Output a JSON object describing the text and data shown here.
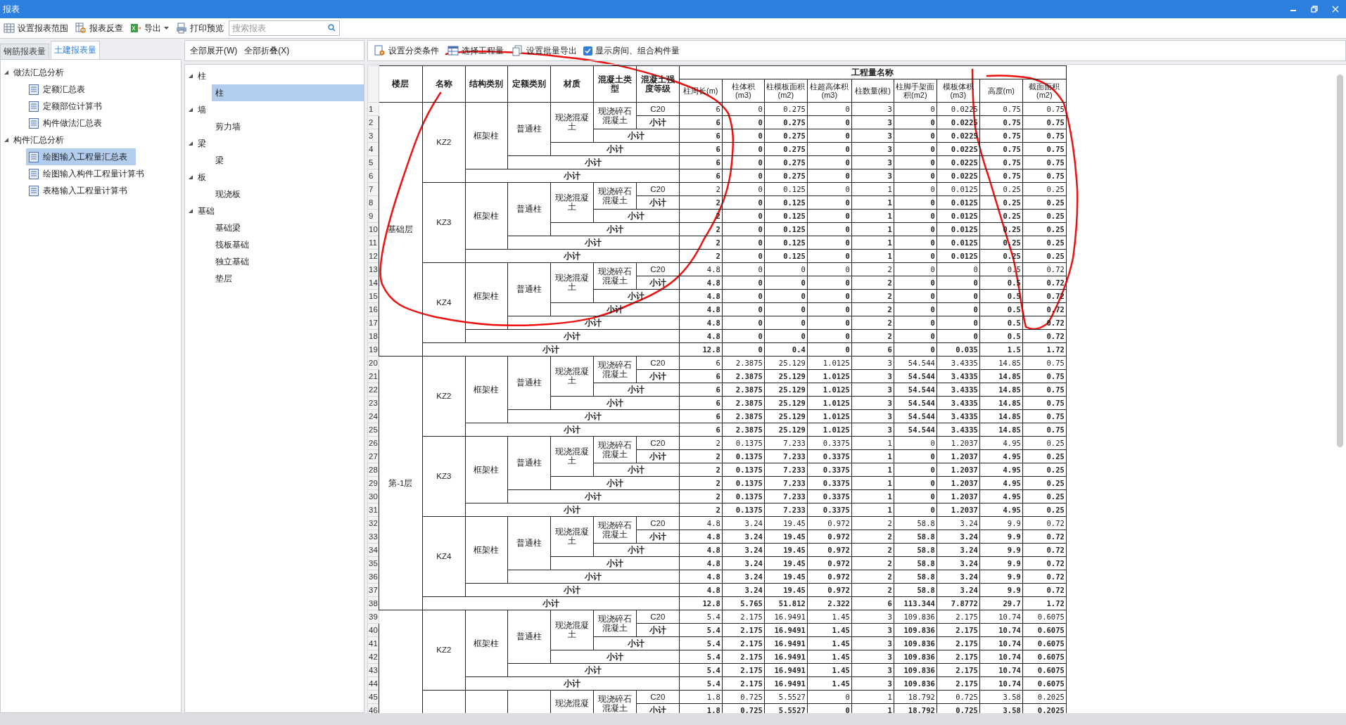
{
  "window": {
    "title": "报表"
  },
  "toolbar": {
    "buttons": [
      {
        "label": "设置报表范围",
        "kind": "range",
        "dropdown": false
      },
      {
        "label": "报表反查",
        "kind": "lookup",
        "dropdown": false
      },
      {
        "label": "导出",
        "kind": "export",
        "dropdown": true
      },
      {
        "label": "打印预览",
        "kind": "print",
        "dropdown": false
      }
    ],
    "search": {
      "placeholder": "搜索报表"
    }
  },
  "left_panel": {
    "tabs": [
      {
        "label": "钢筋报表量",
        "selected": false
      },
      {
        "label": "土建报表量",
        "selected": true
      }
    ],
    "tree": [
      {
        "label": "做法汇总分析",
        "expanded": true,
        "children": [
          {
            "label": "定额汇总表",
            "selected": false
          },
          {
            "label": "定额部位计算书",
            "selected": false
          },
          {
            "label": "构件做法汇总表",
            "selected": false
          }
        ]
      },
      {
        "label": "构件汇总分析",
        "expanded": true,
        "children": [
          {
            "label": "绘图输入工程量汇总表",
            "selected": true
          },
          {
            "label": "绘图输入构件工程量计算书",
            "selected": false
          },
          {
            "label": "表格输入工程量计算书",
            "selected": false
          }
        ]
      }
    ]
  },
  "middle_panel": {
    "buttons": [
      "全部展开(W)",
      "全部折叠(X)"
    ],
    "tree": [
      {
        "label": "柱",
        "expanded": true,
        "children": [
          {
            "label": "柱",
            "selected": true
          }
        ]
      },
      {
        "label": "墙",
        "expanded": true,
        "children": [
          {
            "label": "剪力墙",
            "selected": false
          }
        ]
      },
      {
        "label": "梁",
        "expanded": true,
        "children": [
          {
            "label": "梁",
            "selected": false
          }
        ]
      },
      {
        "label": "板",
        "expanded": true,
        "children": [
          {
            "label": "现浇板",
            "selected": false
          }
        ]
      },
      {
        "label": "基础",
        "expanded": true,
        "children": [
          {
            "label": "基础梁",
            "selected": false
          },
          {
            "label": "筏板基础",
            "selected": false
          },
          {
            "label": "独立基础",
            "selected": false
          },
          {
            "label": "垫层",
            "selected": false
          }
        ]
      }
    ]
  },
  "report_toolbar": {
    "buttons": [
      {
        "label": "设置分类条件",
        "kind": "classify"
      },
      {
        "label": "选择工程量",
        "kind": "select"
      },
      {
        "label": "设置批量导出",
        "kind": "batch"
      }
    ],
    "checkbox": {
      "label": "显示房间、组合构件量",
      "checked": true
    }
  },
  "table": {
    "header": {
      "fixed": [
        "楼层",
        "名称",
        "结构类别",
        "定额类别",
        "材质",
        "混凝土类型",
        "混凝土强度等级"
      ],
      "group": "工程量名称",
      "quantities": [
        "柱周长(m)",
        "柱体积(m3)",
        "柱模板面积(m2)",
        "柱超高体积(m3)",
        "柱数量(根)",
        "柱脚手架面积(m2)",
        "模板体积(m3)",
        "高度(m)",
        "截面面积(m2)"
      ]
    },
    "floors": [
      {
        "name": "基础层",
        "groups": [
          {
            "name": "KZ2",
            "structure": "框架柱",
            "quota": "普通柱",
            "material": "现浇混凝土",
            "concrete": "现浇碎石混凝土",
            "rows": [
              {
                "num": "1",
                "kind": "detail",
                "label": "C20",
                "values": [
                  "6",
                  "0",
                  "0.275",
                  "0",
                  "3",
                  "0",
                  "0.0225",
                  "0.75",
                  "0.75"
                ]
              },
              {
                "num": "2",
                "kind": "subtotal",
                "label": "小计",
                "values": [
                  "6",
                  "0",
                  "0.275",
                  "0",
                  "3",
                  "0",
                  "0.0225",
                  "0.75",
                  "0.75"
                ]
              },
              {
                "num": "3",
                "kind": "subtotal",
                "label": "小计",
                "values": [
                  "6",
                  "0",
                  "0.275",
                  "0",
                  "3",
                  "0",
                  "0.0225",
                  "0.75",
                  "0.75"
                ]
              },
              {
                "num": "4",
                "kind": "subtotal",
                "label": "小计",
                "values": [
                  "6",
                  "0",
                  "0.275",
                  "0",
                  "3",
                  "0",
                  "0.0225",
                  "0.75",
                  "0.75"
                ]
              },
              {
                "num": "5",
                "kind": "subtotal",
                "label": "小计",
                "values": [
                  "6",
                  "0",
                  "0.275",
                  "0",
                  "3",
                  "0",
                  "0.0225",
                  "0.75",
                  "0.75"
                ]
              },
              {
                "num": "6",
                "kind": "subtotal",
                "label": "小计",
                "values": [
                  "6",
                  "0",
                  "0.275",
                  "0",
                  "3",
                  "0",
                  "0.0225",
                  "0.75",
                  "0.75"
                ]
              }
            ]
          },
          {
            "name": "KZ3",
            "structure": "框架柱",
            "quota": "普通柱",
            "material": "现浇混凝土",
            "concrete": "现浇碎石混凝土",
            "rows": [
              {
                "num": "7",
                "kind": "detail",
                "label": "C20",
                "values": [
                  "2",
                  "0",
                  "0.125",
                  "0",
                  "1",
                  "0",
                  "0.0125",
                  "0.25",
                  "0.25"
                ]
              },
              {
                "num": "8",
                "kind": "subtotal",
                "label": "小计",
                "values": [
                  "2",
                  "0",
                  "0.125",
                  "0",
                  "1",
                  "0",
                  "0.0125",
                  "0.25",
                  "0.25"
                ]
              },
              {
                "num": "9",
                "kind": "subtotal",
                "label": "小计",
                "values": [
                  "2",
                  "0",
                  "0.125",
                  "0",
                  "1",
                  "0",
                  "0.0125",
                  "0.25",
                  "0.25"
                ]
              },
              {
                "num": "10",
                "kind": "subtotal",
                "label": "小计",
                "values": [
                  "2",
                  "0",
                  "0.125",
                  "0",
                  "1",
                  "0",
                  "0.0125",
                  "0.25",
                  "0.25"
                ]
              },
              {
                "num": "11",
                "kind": "subtotal",
                "label": "小计",
                "values": [
                  "2",
                  "0",
                  "0.125",
                  "0",
                  "1",
                  "0",
                  "0.0125",
                  "0.25",
                  "0.25"
                ]
              },
              {
                "num": "12",
                "kind": "subtotal",
                "label": "小计",
                "values": [
                  "2",
                  "0",
                  "0.125",
                  "0",
                  "1",
                  "0",
                  "0.0125",
                  "0.25",
                  "0.25"
                ]
              }
            ]
          },
          {
            "name": "KZ4",
            "structure": "框架柱",
            "quota": "普通柱",
            "material": "现浇混凝土",
            "concrete": "现浇碎石混凝土",
            "rows": [
              {
                "num": "13",
                "kind": "detail",
                "label": "C20",
                "values": [
                  "4.8",
                  "0",
                  "0",
                  "0",
                  "2",
                  "0",
                  "0",
                  "0.5",
                  "0.72"
                ]
              },
              {
                "num": "14",
                "kind": "subtotal",
                "label": "小计",
                "values": [
                  "4.8",
                  "0",
                  "0",
                  "0",
                  "2",
                  "0",
                  "0",
                  "0.5",
                  "0.72"
                ]
              },
              {
                "num": "15",
                "kind": "subtotal",
                "label": "小计",
                "values": [
                  "4.8",
                  "0",
                  "0",
                  "0",
                  "2",
                  "0",
                  "0",
                  "0.5",
                  "0.72"
                ]
              },
              {
                "num": "16",
                "kind": "subtotal",
                "label": "小计",
                "values": [
                  "4.8",
                  "0",
                  "0",
                  "0",
                  "2",
                  "0",
                  "0",
                  "0.5",
                  "0.72"
                ]
              },
              {
                "num": "17",
                "kind": "subtotal",
                "label": "小计",
                "values": [
                  "4.8",
                  "0",
                  "0",
                  "0",
                  "2",
                  "0",
                  "0",
                  "0.5",
                  "0.72"
                ]
              },
              {
                "num": "18",
                "kind": "subtotal",
                "label": "小计",
                "values": [
                  "4.8",
                  "0",
                  "0",
                  "0",
                  "2",
                  "0",
                  "0",
                  "0.5",
                  "0.72"
                ]
              }
            ]
          }
        ],
        "total": {
          "num": "19",
          "label": "小计",
          "values": [
            "12.8",
            "0",
            "0.4",
            "0",
            "6",
            "0",
            "0.035",
            "1.5",
            "1.72"
          ]
        }
      },
      {
        "name": "第-1层",
        "groups": [
          {
            "name": "KZ2",
            "structure": "框架柱",
            "quota": "普通柱",
            "material": "现浇混凝土",
            "concrete": "现浇碎石混凝土",
            "rows": [
              {
                "num": "20",
                "kind": "detail",
                "label": "C20",
                "values": [
                  "6",
                  "2.3875",
                  "25.129",
                  "1.0125",
                  "3",
                  "54.544",
                  "3.4335",
                  "14.85",
                  "0.75"
                ]
              },
              {
                "num": "21",
                "kind": "subtotal",
                "label": "小计",
                "values": [
                  "6",
                  "2.3875",
                  "25.129",
                  "1.0125",
                  "3",
                  "54.544",
                  "3.4335",
                  "14.85",
                  "0.75"
                ]
              },
              {
                "num": "22",
                "kind": "subtotal",
                "label": "小计",
                "values": [
                  "6",
                  "2.3875",
                  "25.129",
                  "1.0125",
                  "3",
                  "54.544",
                  "3.4335",
                  "14.85",
                  "0.75"
                ]
              },
              {
                "num": "23",
                "kind": "subtotal",
                "label": "小计",
                "values": [
                  "6",
                  "2.3875",
                  "25.129",
                  "1.0125",
                  "3",
                  "54.544",
                  "3.4335",
                  "14.85",
                  "0.75"
                ]
              },
              {
                "num": "24",
                "kind": "subtotal",
                "label": "小计",
                "values": [
                  "6",
                  "2.3875",
                  "25.129",
                  "1.0125",
                  "3",
                  "54.544",
                  "3.4335",
                  "14.85",
                  "0.75"
                ]
              },
              {
                "num": "25",
                "kind": "subtotal",
                "label": "小计",
                "values": [
                  "6",
                  "2.3875",
                  "25.129",
                  "1.0125",
                  "3",
                  "54.544",
                  "3.4335",
                  "14.85",
                  "0.75"
                ]
              }
            ]
          },
          {
            "name": "KZ3",
            "structure": "框架柱",
            "quota": "普通柱",
            "material": "现浇混凝土",
            "concrete": "现浇碎石混凝土",
            "rows": [
              {
                "num": "26",
                "kind": "detail",
                "label": "C20",
                "values": [
                  "2",
                  "0.1375",
                  "7.233",
                  "0.3375",
                  "1",
                  "0",
                  "1.2037",
                  "4.95",
                  "0.25"
                ]
              },
              {
                "num": "27",
                "kind": "subtotal",
                "label": "小计",
                "values": [
                  "2",
                  "0.1375",
                  "7.233",
                  "0.3375",
                  "1",
                  "0",
                  "1.2037",
                  "4.95",
                  "0.25"
                ]
              },
              {
                "num": "28",
                "kind": "subtotal",
                "label": "小计",
                "values": [
                  "2",
                  "0.1375",
                  "7.233",
                  "0.3375",
                  "1",
                  "0",
                  "1.2037",
                  "4.95",
                  "0.25"
                ]
              },
              {
                "num": "29",
                "kind": "subtotal",
                "label": "小计",
                "values": [
                  "2",
                  "0.1375",
                  "7.233",
                  "0.3375",
                  "1",
                  "0",
                  "1.2037",
                  "4.95",
                  "0.25"
                ]
              },
              {
                "num": "30",
                "kind": "subtotal",
                "label": "小计",
                "values": [
                  "2",
                  "0.1375",
                  "7.233",
                  "0.3375",
                  "1",
                  "0",
                  "1.2037",
                  "4.95",
                  "0.25"
                ]
              },
              {
                "num": "31",
                "kind": "subtotal",
                "label": "小计",
                "values": [
                  "2",
                  "0.1375",
                  "7.233",
                  "0.3375",
                  "1",
                  "0",
                  "1.2037",
                  "4.95",
                  "0.25"
                ]
              }
            ]
          },
          {
            "name": "KZ4",
            "structure": "框架柱",
            "quota": "普通柱",
            "material": "现浇混凝土",
            "concrete": "现浇碎石混凝土",
            "rows": [
              {
                "num": "32",
                "kind": "detail",
                "label": "C20",
                "values": [
                  "4.8",
                  "3.24",
                  "19.45",
                  "0.972",
                  "2",
                  "58.8",
                  "3.24",
                  "9.9",
                  "0.72"
                ]
              },
              {
                "num": "33",
                "kind": "subtotal",
                "label": "小计",
                "values": [
                  "4.8",
                  "3.24",
                  "19.45",
                  "0.972",
                  "2",
                  "58.8",
                  "3.24",
                  "9.9",
                  "0.72"
                ]
              },
              {
                "num": "34",
                "kind": "subtotal",
                "label": "小计",
                "values": [
                  "4.8",
                  "3.24",
                  "19.45",
                  "0.972",
                  "2",
                  "58.8",
                  "3.24",
                  "9.9",
                  "0.72"
                ]
              },
              {
                "num": "35",
                "kind": "subtotal",
                "label": "小计",
                "values": [
                  "4.8",
                  "3.24",
                  "19.45",
                  "0.972",
                  "2",
                  "58.8",
                  "3.24",
                  "9.9",
                  "0.72"
                ]
              },
              {
                "num": "36",
                "kind": "subtotal",
                "label": "小计",
                "values": [
                  "4.8",
                  "3.24",
                  "19.45",
                  "0.972",
                  "2",
                  "58.8",
                  "3.24",
                  "9.9",
                  "0.72"
                ]
              },
              {
                "num": "37",
                "kind": "subtotal",
                "label": "小计",
                "values": [
                  "4.8",
                  "3.24",
                  "19.45",
                  "0.972",
                  "2",
                  "58.8",
                  "3.24",
                  "9.9",
                  "0.72"
                ]
              }
            ]
          }
        ],
        "total": {
          "num": "38",
          "label": "小计",
          "values": [
            "12.8",
            "5.765",
            "51.812",
            "2.322",
            "6",
            "113.344",
            "7.8772",
            "29.7",
            "1.72"
          ]
        }
      },
      {
        "groups": [
          {
            "name": "KZ2",
            "structure": "框架柱",
            "quota": "普通柱",
            "material": "现浇混凝土",
            "concrete": "现浇碎石混凝土",
            "rows": [
              {
                "num": "39",
                "kind": "detail",
                "label": "C20",
                "values": [
                  "5.4",
                  "2.175",
                  "16.9491",
                  "1.45",
                  "3",
                  "109.836",
                  "2.175",
                  "10.74",
                  "0.6075"
                ]
              },
              {
                "num": "40",
                "kind": "subtotal",
                "label": "小计",
                "values": [
                  "5.4",
                  "2.175",
                  "16.9491",
                  "1.45",
                  "3",
                  "109.836",
                  "2.175",
                  "10.74",
                  "0.6075"
                ]
              },
              {
                "num": "41",
                "kind": "subtotal",
                "label": "小计",
                "values": [
                  "5.4",
                  "2.175",
                  "16.9491",
                  "1.45",
                  "3",
                  "109.836",
                  "2.175",
                  "10.74",
                  "0.6075"
                ]
              },
              {
                "num": "42",
                "kind": "subtotal",
                "label": "小计",
                "values": [
                  "5.4",
                  "2.175",
                  "16.9491",
                  "1.45",
                  "3",
                  "109.836",
                  "2.175",
                  "10.74",
                  "0.6075"
                ]
              },
              {
                "num": "43",
                "kind": "subtotal",
                "label": "小计",
                "values": [
                  "5.4",
                  "2.175",
                  "16.9491",
                  "1.45",
                  "3",
                  "109.836",
                  "2.175",
                  "10.74",
                  "0.6075"
                ]
              },
              {
                "num": "44",
                "kind": "subtotal",
                "label": "小计",
                "values": [
                  "5.4",
                  "2.175",
                  "16.9491",
                  "1.45",
                  "3",
                  "109.836",
                  "2.175",
                  "10.74",
                  "0.6075"
                ]
              }
            ]
          },
          {
            "material": "现浇混凝",
            "concrete": "现浇碎石混凝土",
            "rows": [
              {
                "num": "45",
                "kind": "detail",
                "label": "C20",
                "values": [
                  "1.8",
                  "0.725",
                  "5.5527",
                  "0",
                  "1",
                  "18.792",
                  "0.725",
                  "3.58",
                  "0.2025"
                ]
              },
              {
                "num": "46",
                "kind": "subtotal",
                "label": "小计",
                "values": [
                  "1.8",
                  "0.725",
                  "5.5527",
                  "0",
                  "1",
                  "18.792",
                  "0.725",
                  "3.58",
                  "0.2025"
                ]
              }
            ]
          }
        ]
      }
    ]
  },
  "markup": {
    "left_loop": true,
    "right_loop": true
  }
}
